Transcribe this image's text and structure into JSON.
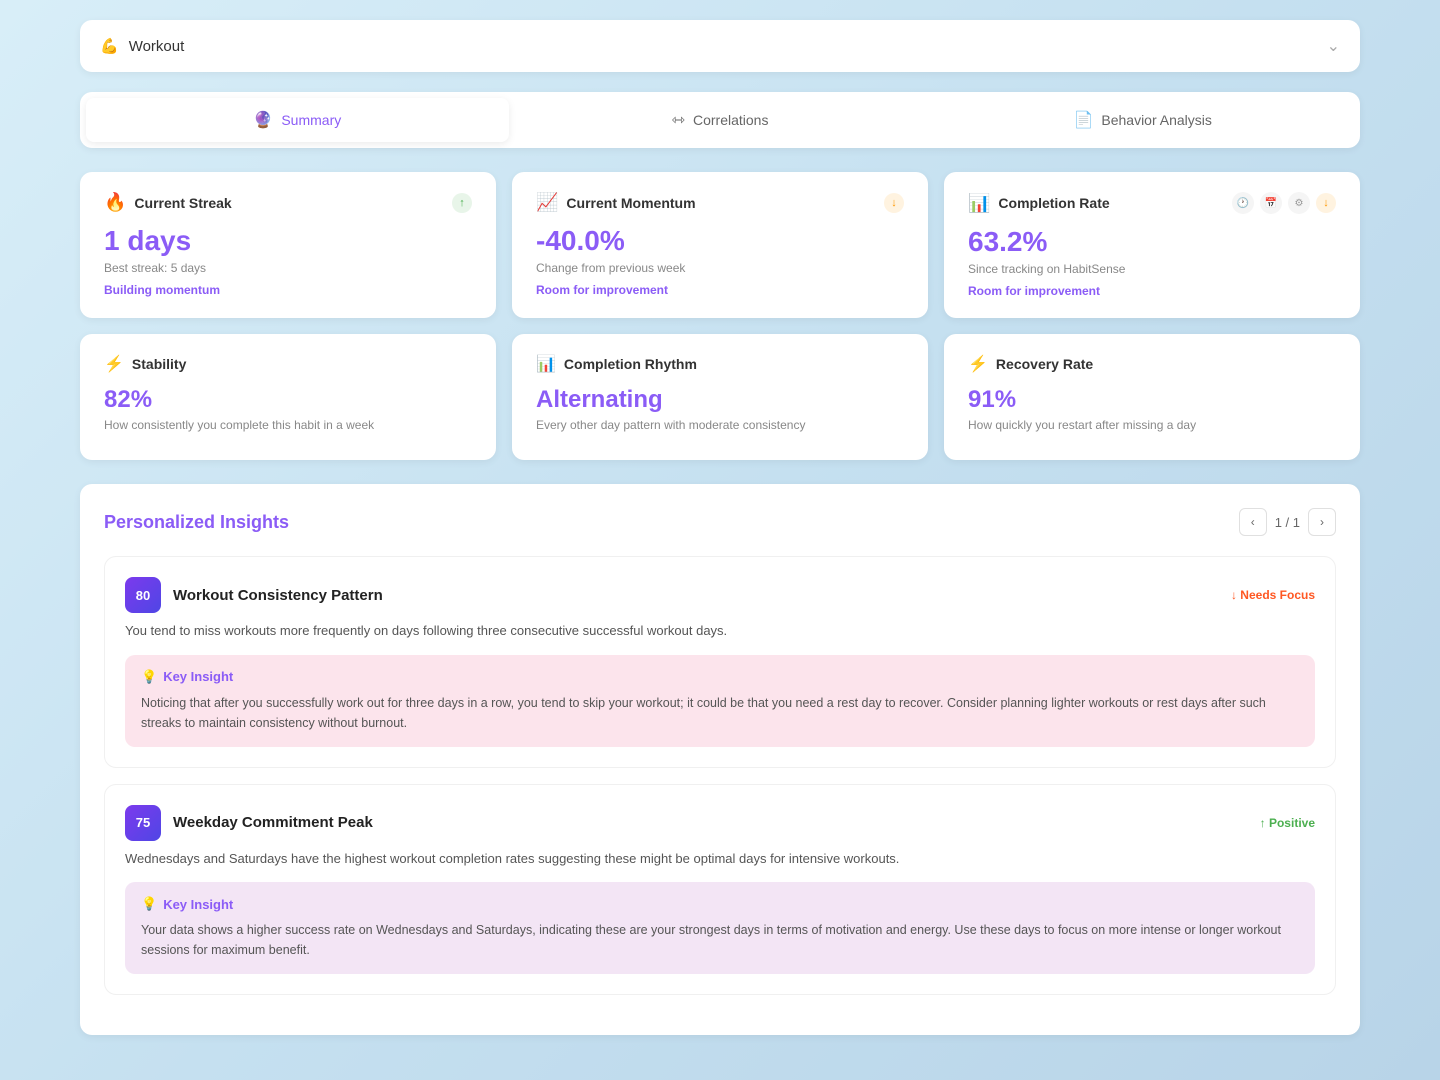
{
  "workout_selector": {
    "icon": "💪",
    "label": "Workout"
  },
  "tabs": [
    {
      "id": "summary",
      "icon": "🔮",
      "label": "Summary",
      "active": true
    },
    {
      "id": "correlations",
      "icon": "⇿",
      "label": "Correlations",
      "active": false
    },
    {
      "id": "behavior",
      "icon": "📄",
      "label": "Behavior Analysis",
      "active": false
    }
  ],
  "stat_cards_row1": [
    {
      "id": "current-streak",
      "icon_type": "flame",
      "title": "Current Streak",
      "badge": "green",
      "badge_text": "↑",
      "value": "1 days",
      "subtitle": "Best streak: 5 days",
      "tag": "Building momentum"
    },
    {
      "id": "current-momentum",
      "icon_type": "trending",
      "title": "Current Momentum",
      "badge": "orange",
      "badge_text": "↓",
      "value": "-40.0%",
      "subtitle": "Change from previous week",
      "tag": "Room for improvement"
    },
    {
      "id": "completion-rate",
      "icon_type": "bar-chart",
      "title": "Completion Rate",
      "badge": "orange",
      "badge_text": "↓",
      "has_header_icons": true,
      "value": "63.2%",
      "subtitle": "Since tracking on HabitSense",
      "tag": "Room for improvement"
    }
  ],
  "stat_cards_row2": [
    {
      "id": "stability",
      "icon_type": "lightning",
      "title": "Stability",
      "value": "82%",
      "desc": "How consistently you complete this habit in a week"
    },
    {
      "id": "completion-rhythm",
      "icon_type": "bar-chart-sm",
      "title": "Completion Rhythm",
      "value": "Alternating",
      "desc": "Every other day pattern with moderate consistency"
    },
    {
      "id": "recovery-rate",
      "icon_type": "lightning",
      "title": "Recovery Rate",
      "value": "91%",
      "desc": "How quickly you restart after missing a day"
    }
  ],
  "insights": {
    "title": "Personalized Insights",
    "pagination": "1 / 1",
    "cards": [
      {
        "score": "80",
        "title": "Workout Consistency Pattern",
        "badge": "needs",
        "badge_text": "↓ Needs Focus",
        "desc": "You tend to miss workouts more frequently on days following three consecutive successful workout days.",
        "key_insight_label": "Key Insight",
        "key_insight_text": "Noticing that after you successfully work out for three days in a row, you tend to skip your workout; it could be that you need a rest day to recover. Consider planning lighter workouts or rest days after such streaks to maintain consistency without burnout."
      },
      {
        "score": "75",
        "title": "Weekday Commitment Peak",
        "badge": "positive",
        "badge_text": "↑ Positive",
        "desc": "Wednesdays and Saturdays have the highest workout completion rates suggesting these might be optimal days for intensive workouts.",
        "key_insight_label": "Key Insight",
        "key_insight_text": "Your data shows a higher success rate on Wednesdays and Saturdays, indicating these are your strongest days in terms of motivation and energy. Use these days to focus on more intense or longer workout sessions for maximum benefit."
      }
    ]
  }
}
